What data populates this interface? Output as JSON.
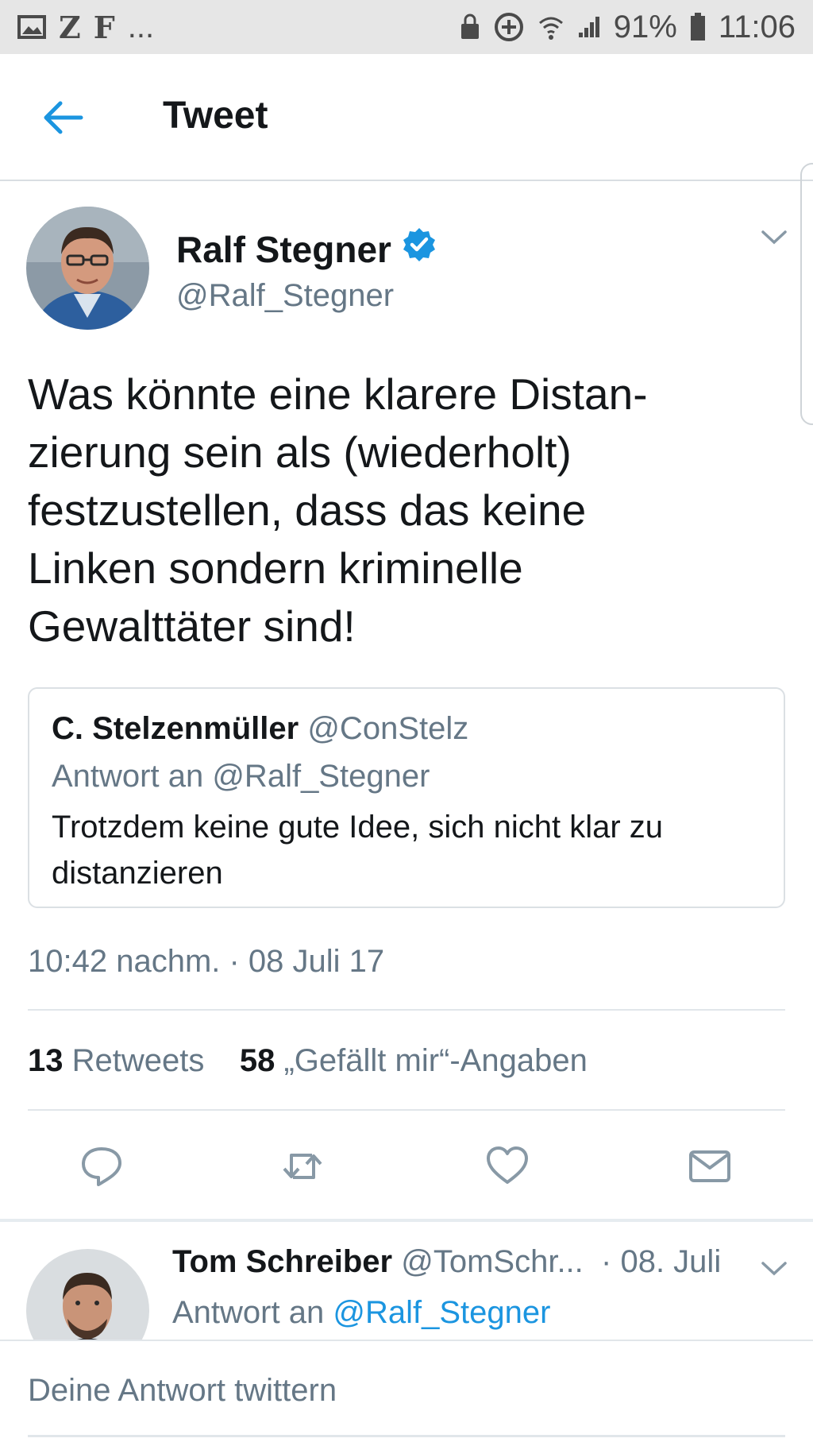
{
  "status_bar": {
    "left_glyphs": [
      "Z",
      "F",
      "..."
    ],
    "battery_percent": "91%",
    "time": "11:06"
  },
  "header": {
    "title": "Tweet",
    "back_icon": "arrow-left-icon",
    "accent_color": "#1b95e0"
  },
  "tweet": {
    "author_name": "Ralf Stegner",
    "author_handle": "@Ralf_Stegner",
    "verified": true,
    "text": "Was könnte eine klarere Distan-\nzierung sein als (wiederholt)\nfestzustellen, dass das keine\nLinken sondern kriminelle\nGewalttäter sind!",
    "quoted": {
      "name": "C. Stelzenmüller",
      "handle": "@ConStelz",
      "reply_to": "Antwort an @Ralf_Stegner",
      "text": "Trotzdem keine gute Idee, sich nicht klar zu distanzieren"
    },
    "timestamp": "10:42 nachm. · 08 Juli 17",
    "retweet_count": "13",
    "retweet_label": "Retweets",
    "like_count": "58",
    "like_label": "„Gefällt mir“-Angaben",
    "actions": [
      "reply-icon",
      "retweet-icon",
      "heart-icon",
      "mail-icon"
    ]
  },
  "reply": {
    "name": "Tom Schreiber",
    "handle": "@TomSchr...",
    "date": "· 08. Juli",
    "reply_to_prefix": "Antwort an",
    "reply_to_handle": "@Ralf_Stegner"
  },
  "compose": {
    "placeholder": "Deine Antwort twittern"
  }
}
